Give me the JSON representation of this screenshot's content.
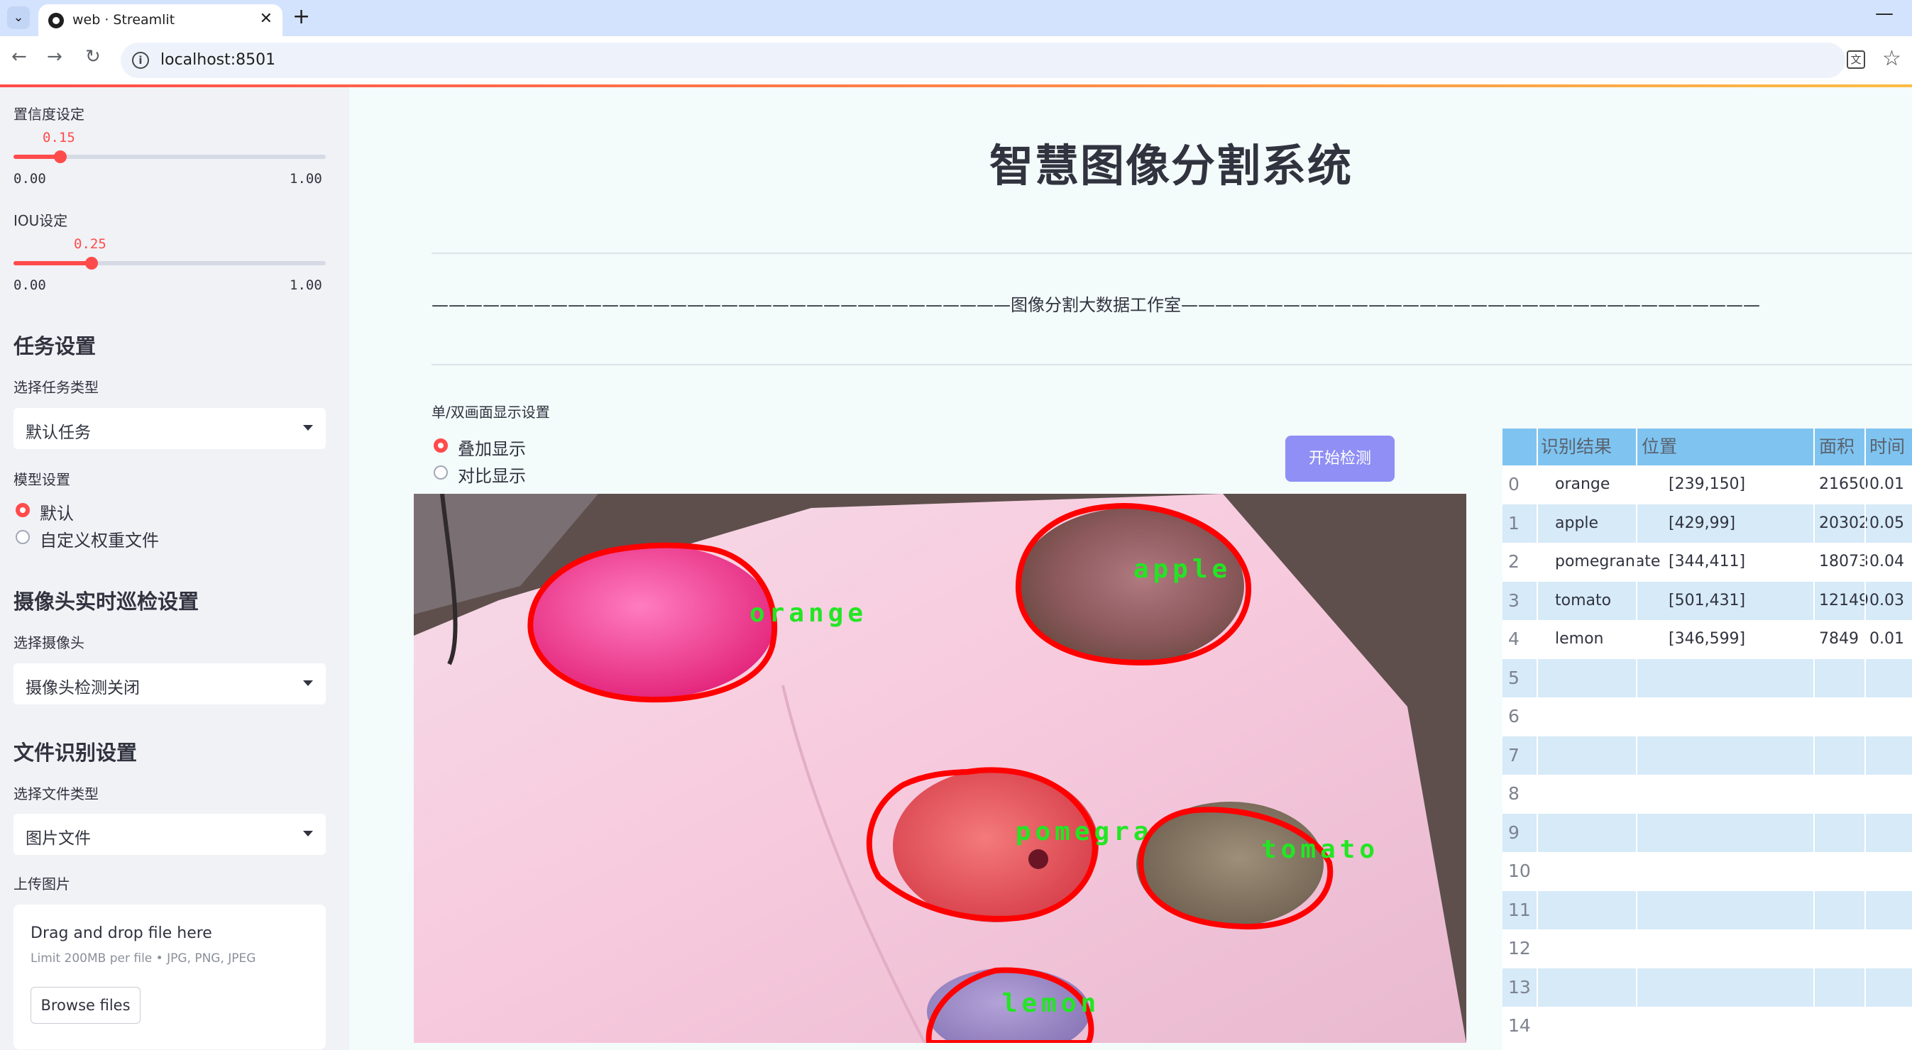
{
  "browser": {
    "tab_title": "web · Streamlit",
    "url": "localhost:8501",
    "nav": {
      "back": "←",
      "forward": "→",
      "reload": "↻"
    }
  },
  "sidebar": {
    "conf_label": "置信度设定",
    "conf_value": "0.15",
    "conf_min": "0.00",
    "conf_max": "1.00",
    "conf_level": 0.15,
    "iou_label": "IOU设定",
    "iou_value": "0.25",
    "iou_min": "0.00",
    "iou_max": "1.00",
    "iou_level": 0.25,
    "task_heading": "任务设置",
    "task_type_label": "选择任务类型",
    "task_type_value": "默认任务",
    "model_label": "模型设置",
    "model_options": [
      "默认",
      "自定义权重文件"
    ],
    "model_selected": 0,
    "camera_heading": "摄像头实时巡检设置",
    "camera_label": "选择摄像头",
    "camera_value": "摄像头检测关闭",
    "file_heading": "文件识别设置",
    "file_type_label": "选择文件类型",
    "file_type_value": "图片文件",
    "upload_label": "上传图片",
    "upload_title": "Drag and drop file here",
    "upload_limit": "Limit 200MB per file • JPG, PNG, JPEG",
    "browse_label": "Browse files"
  },
  "main": {
    "title": "智慧图像分割系统",
    "studio_line": "——————————————————————————————————图像分割大数据工作室——————————————————————————————————",
    "display_label": "单/双画面显示设置",
    "display_options": [
      "叠加显示",
      "对比显示"
    ],
    "display_selected": 0,
    "detect_button": "开始检测",
    "detections": [
      "orange",
      "apple",
      "pomegranate",
      "tomato",
      "lemon"
    ]
  },
  "table": {
    "headers": [
      "识别结果",
      "位置",
      "面积",
      "时间"
    ],
    "rows": [
      {
        "index": "0",
        "result": "orange",
        "position": "[239,150]",
        "area": "21650",
        "time": "0.01"
      },
      {
        "index": "1",
        "result": "apple",
        "position": "[429,99]",
        "area": "20302",
        "time": "0.05"
      },
      {
        "index": "2",
        "result": "pomegranate",
        "position": "[344,411]",
        "area": "18073",
        "time": "0.04"
      },
      {
        "index": "3",
        "result": "tomato",
        "position": "[501,431]",
        "area": "12149",
        "time": "0.03"
      },
      {
        "index": "4",
        "result": "lemon",
        "position": "[346,599]",
        "area": "7849",
        "time": "0.01"
      },
      {
        "index": "5",
        "result": "",
        "position": "",
        "area": "",
        "time": ""
      },
      {
        "index": "6",
        "result": "",
        "position": "",
        "area": "",
        "time": ""
      },
      {
        "index": "7",
        "result": "",
        "position": "",
        "area": "",
        "time": ""
      },
      {
        "index": "8",
        "result": "",
        "position": "",
        "area": "",
        "time": ""
      },
      {
        "index": "9",
        "result": "",
        "position": "",
        "area": "",
        "time": ""
      },
      {
        "index": "10",
        "result": "",
        "position": "",
        "area": "",
        "time": ""
      },
      {
        "index": "11",
        "result": "",
        "position": "",
        "area": "",
        "time": ""
      },
      {
        "index": "12",
        "result": "",
        "position": "",
        "area": "",
        "time": ""
      },
      {
        "index": "13",
        "result": "",
        "position": "",
        "area": "",
        "time": ""
      },
      {
        "index": "14",
        "result": "",
        "position": "",
        "area": "",
        "time": ""
      }
    ]
  },
  "colors": {
    "accent": "#ff4b4b",
    "button": "#8f8ff5",
    "table_header": "#7fc4f0",
    "row_alt": "#d6eaf8",
    "mask_outline": "#ff0000",
    "label_green": "#22e622"
  }
}
